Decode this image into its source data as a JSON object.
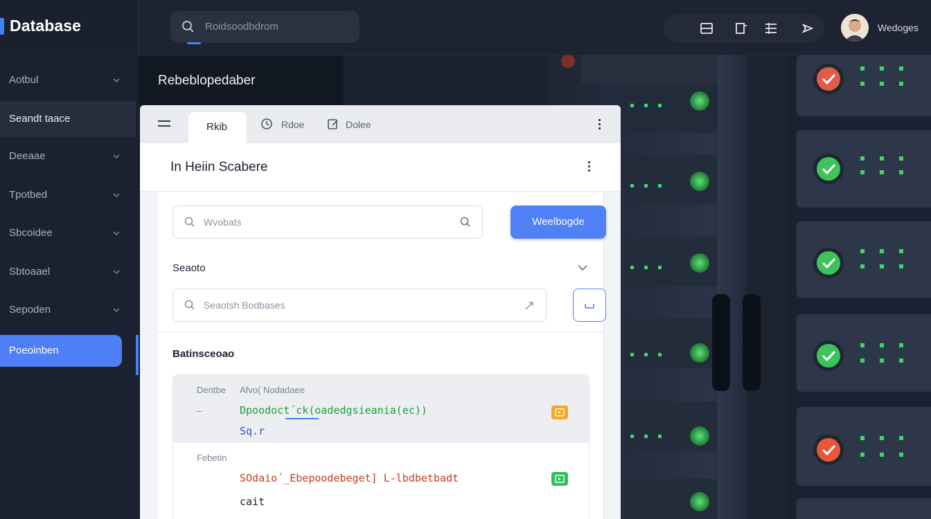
{
  "brand": {
    "title": "Database"
  },
  "search": {
    "placeholder": "Roidsoodbdrom"
  },
  "user": {
    "name": "Wedoges"
  },
  "sidebar": {
    "items": [
      {
        "label": "Aotbul",
        "chevron": true
      },
      {
        "label": "Seandt taace",
        "chevron": false
      },
      {
        "label": "Deeaae",
        "chevron": true
      },
      {
        "label": "Tpotbed",
        "chevron": true
      },
      {
        "label": "Sbcoidee",
        "chevron": true
      },
      {
        "label": "Sbtoaael",
        "chevron": true
      },
      {
        "label": "Sepoden",
        "chevron": true
      }
    ],
    "active_item": "Poeoinben"
  },
  "page": {
    "heading": "Rebeblopedaber"
  },
  "panel": {
    "tabs": [
      {
        "label": "Rkib",
        "active": true
      },
      {
        "label": "Rdoe",
        "active": false
      },
      {
        "label": "Dolee",
        "active": false
      }
    ],
    "title": "In Heiin Scabere",
    "filter_placeholder": "Wvobats",
    "primary_button": "Weelbogde",
    "section_label": "Seaoto",
    "section_search_placeholder": "Seaotsh Bodbases",
    "results_label": "Batinsceoao",
    "code_card": {
      "col1_header": "Dentbe",
      "col2_header": "Afvo( Nodadaee",
      "row1_line1": "Dpoodoct´ck(oadedgsieania(ec))",
      "row1_line2": "Sq.r",
      "row2_header": "Febetin",
      "row2_line1": "SOdaio´_Ebepoodebeget] L-lbdbetbadt",
      "row2_line2": "cait"
    }
  },
  "colors": {
    "accent": "#4f80f6",
    "sidebar_bg": "#1b2130",
    "topbar_bg": "#1d2330",
    "status_ok": "#3cc35a",
    "status_error": "#e8503a",
    "badge_orange": "#f5a623",
    "badge_green": "#2fbf5e"
  },
  "icons": {
    "search": "search-icon",
    "tools": [
      "window-icon",
      "crop-icon",
      "list-icon",
      "send-icon"
    ],
    "chevron": "chevron-down-icon"
  }
}
